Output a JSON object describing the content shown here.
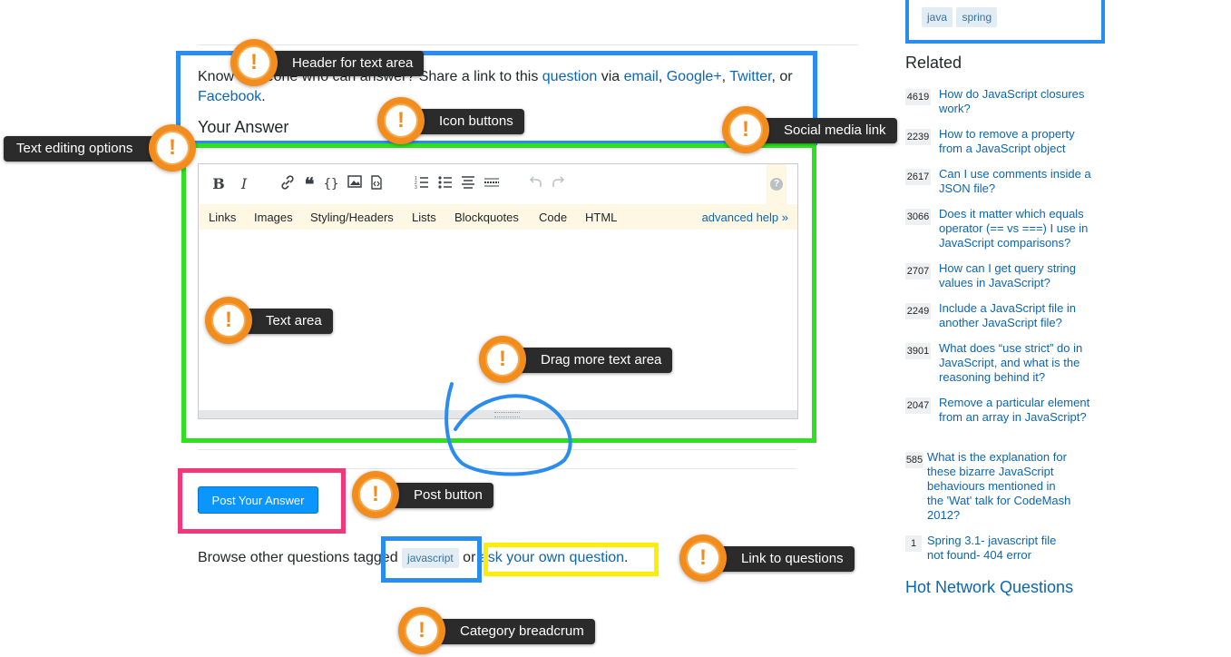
{
  "share": {
    "prefix": "Know someone who can answer? Share a link to this ",
    "question_link": "question",
    "via": " via ",
    "email": "email",
    "google": "Google+",
    "twitter": "Twitter",
    "or": ", or",
    "facebook": "Facebook",
    "period": "."
  },
  "answer_heading": "Your Answer",
  "editor": {
    "toolbar_icons": [
      "bold-icon",
      "italic-icon",
      "link-icon",
      "blockquote-icon",
      "code-icon",
      "image-icon",
      "snippet-icon",
      "ordered-list-icon",
      "unordered-list-icon",
      "heading-icon",
      "horizontal-rule-icon",
      "undo-icon",
      "redo-icon"
    ],
    "help_icon": "?",
    "help_tabs": [
      "Links",
      "Images",
      "Styling/Headers",
      "Lists",
      "Blockquotes",
      "Code",
      "HTML"
    ],
    "advanced_help": "advanced help »",
    "textarea_value": ""
  },
  "post_button": "Post Your Answer",
  "browse": {
    "prefix": "Browse other questions tagged ",
    "tag": "javascript",
    "or": " or ",
    "ask_link": "ask your own question",
    "period": "."
  },
  "sidebar": {
    "top_tags": [
      "java",
      "spring"
    ],
    "related_title": "Related",
    "related": [
      {
        "score": "4619",
        "title": "How do JavaScript closures work?"
      },
      {
        "score": "2239",
        "title": "How to remove a property from a JavaScript object"
      },
      {
        "score": "2617",
        "title": "Can I use comments inside a JSON file?"
      },
      {
        "score": "3066",
        "title": "Does it matter which equals operator (== vs ===) I use in JavaScript comparisons?"
      },
      {
        "score": "2707",
        "title": "How can I get query string values in JavaScript?"
      },
      {
        "score": "2249",
        "title": "Include a JavaScript file in another JavaScript file?"
      },
      {
        "score": "3901",
        "title": "What does “use strict” do in JavaScript, and what is the reasoning behind it?"
      },
      {
        "score": "2047",
        "title": "Remove a particular element from an array in JavaScript?"
      },
      {
        "score": "585",
        "title": "What is the explanation for these bizarre JavaScript behaviours mentioned in the 'Wat' talk for CodeMash 2012?"
      },
      {
        "score": "1",
        "title": "Spring 3.1- javascript file not found- 404 error"
      }
    ],
    "hot_network": "Hot Network Questions"
  },
  "callouts": {
    "header": "Header for text area",
    "icons": "Icon buttons",
    "social": "Social media link",
    "text_options": "Text editing options",
    "text_area": "Text area",
    "drag": "Drag more text area",
    "post": "Post button",
    "link_questions": "Link to questions",
    "category": "Category breadcrum",
    "pin_glyph": "!"
  },
  "colors": {
    "blue_box": "#2b8cf0",
    "green_box": "#2ee01f",
    "pink_box": "#f0387a",
    "yellow_box": "#ffee00",
    "callout_orange": "#f28c1c",
    "link": "#0c65b5",
    "button": "#0a95ff"
  }
}
